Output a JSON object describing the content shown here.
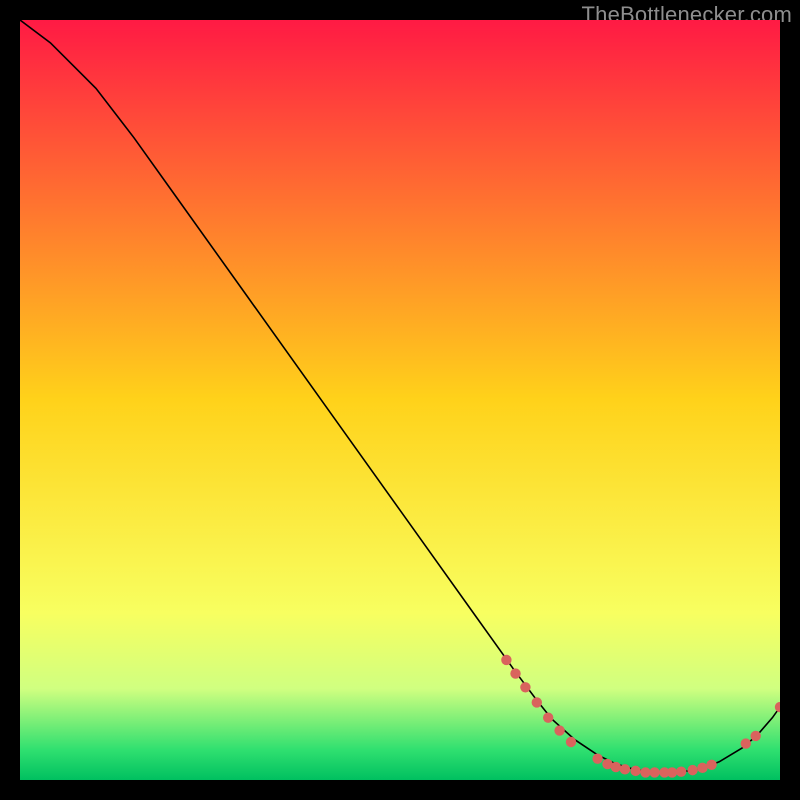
{
  "watermark": "TheBottlenecker.com",
  "chart_data": {
    "type": "line",
    "title": "",
    "xlabel": "",
    "ylabel": "",
    "xlim": [
      0,
      100
    ],
    "ylim": [
      0,
      100
    ],
    "background": {
      "stops": [
        {
          "pos": 0.0,
          "color": "#ff1a44"
        },
        {
          "pos": 0.5,
          "color": "#ffd21a"
        },
        {
          "pos": 0.78,
          "color": "#f8ff60"
        },
        {
          "pos": 0.88,
          "color": "#d0ff80"
        },
        {
          "pos": 0.96,
          "color": "#30e070"
        },
        {
          "pos": 1.0,
          "color": "#00c060"
        }
      ]
    },
    "series": [
      {
        "name": "curve",
        "color": "#000000",
        "width": 1.6,
        "x": [
          0,
          4,
          8,
          10,
          15,
          20,
          30,
          40,
          50,
          60,
          65,
          68,
          70,
          73,
          76,
          78,
          80,
          82,
          84,
          86,
          88,
          90,
          92,
          95,
          97,
          99,
          100
        ],
        "y": [
          100,
          97,
          93,
          91,
          84.5,
          77.5,
          63.5,
          49.5,
          35.5,
          21.5,
          14.5,
          10.5,
          8.0,
          5.3,
          3.3,
          2.3,
          1.6,
          1.2,
          1.0,
          1.0,
          1.2,
          1.6,
          2.4,
          4.2,
          5.9,
          8.2,
          9.6
        ]
      }
    ],
    "markers": {
      "color": "#d9635d",
      "radius": 5.2,
      "points": [
        {
          "x": 64.0,
          "y": 15.8
        },
        {
          "x": 65.2,
          "y": 14.0
        },
        {
          "x": 66.5,
          "y": 12.2
        },
        {
          "x": 68.0,
          "y": 10.2
        },
        {
          "x": 69.5,
          "y": 8.2
        },
        {
          "x": 71.0,
          "y": 6.5
        },
        {
          "x": 72.5,
          "y": 5.0
        },
        {
          "x": 76.0,
          "y": 2.8
        },
        {
          "x": 77.3,
          "y": 2.1
        },
        {
          "x": 78.4,
          "y": 1.7
        },
        {
          "x": 79.6,
          "y": 1.4
        },
        {
          "x": 81.0,
          "y": 1.2
        },
        {
          "x": 82.3,
          "y": 1.0
        },
        {
          "x": 83.5,
          "y": 1.0
        },
        {
          "x": 84.8,
          "y": 1.0
        },
        {
          "x": 85.8,
          "y": 1.0
        },
        {
          "x": 87.0,
          "y": 1.1
        },
        {
          "x": 88.5,
          "y": 1.3
        },
        {
          "x": 89.8,
          "y": 1.6
        },
        {
          "x": 91.0,
          "y": 2.0
        },
        {
          "x": 95.5,
          "y": 4.8
        },
        {
          "x": 96.8,
          "y": 5.8
        },
        {
          "x": 100.0,
          "y": 9.6
        }
      ]
    }
  }
}
